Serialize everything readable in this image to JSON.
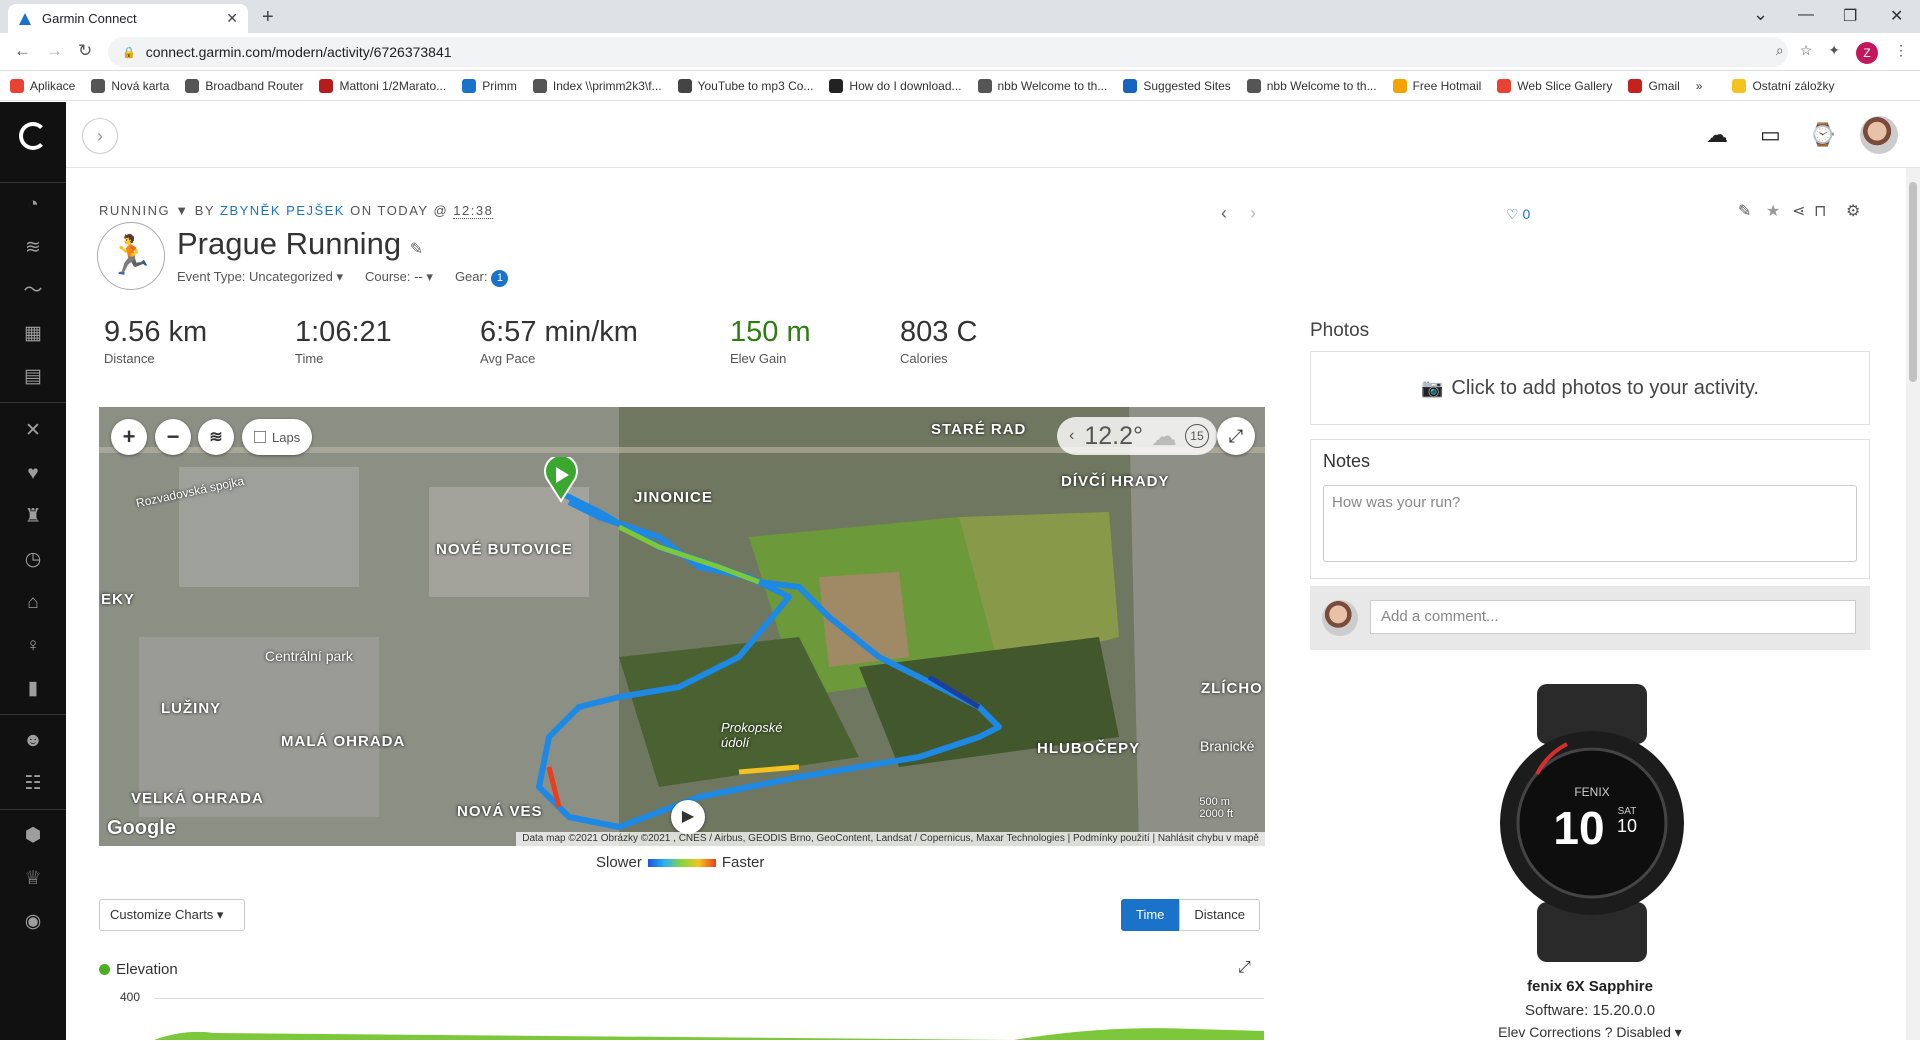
{
  "browser": {
    "tab_title": "Garmin Connect",
    "url": "connect.garmin.com/modern/activity/6726373841",
    "profile_initial": "Z",
    "bookmarks": [
      "Aplikace",
      "Nová karta",
      "Broadband Router",
      "Mattoni 1/2Marato...",
      "Primm",
      "Index \\\\primm2k3\\f...",
      "YouTube to mp3 Co...",
      "How do I download...",
      "nbb Welcome to th...",
      "Suggested Sites",
      "nbb Welcome to th...",
      "Free Hotmail",
      "Web Slice Gallery",
      "Gmail",
      "»",
      "Ostatní záložky"
    ]
  },
  "activity": {
    "type_label": "RUNNING",
    "by_label": "BY",
    "author": "ZBYNĚK PEJŠEK",
    "on_label": "ON TODAY @",
    "time": "12:38",
    "title": "Prague Running",
    "event_type": "Event Type: Uncategorized ▾",
    "course": "Course: -- ▾",
    "gear_label": "Gear:",
    "gear_count": "1",
    "likes": "0"
  },
  "stats": [
    {
      "value": "9.56 km",
      "label": "Distance"
    },
    {
      "value": "1:06:21",
      "label": "Time"
    },
    {
      "value": "6:57 min/km",
      "label": "Avg Pace"
    },
    {
      "value": "150 m",
      "label": "Elev Gain"
    },
    {
      "value": "803 C",
      "label": "Calories"
    }
  ],
  "map": {
    "laps_label": "Laps",
    "temperature": "12.2°",
    "weather_badge": "15",
    "labels": [
      "STARÉ RAD",
      "JINONICE",
      "DÍVČÍ HRADY",
      "NOVÉ BUTOVICE",
      "Rozvadovská spojka",
      "Centrální park",
      "LUŽINY",
      "MALÁ OHRADA",
      "VELKÁ OHRADA",
      "NOVÁ VES",
      "Prokopské údolí",
      "HLUBOČEPY",
      "ZLÍCHO",
      "Branické",
      "EKY"
    ],
    "scale_1": "500 m",
    "scale_2": "2000 ft",
    "attribution": "Data map ©2021 Obrázky ©2021 , CNES / Airbus, GEODIS Brno, GeoContent, Landsat / Copernicus, Maxar Technologies | Podmínky použití | Nahlásit chybu v mapě",
    "logo": "Google"
  },
  "legend": {
    "slow": "Slower",
    "fast": "Faster"
  },
  "charts": {
    "customize_label": "Customize Charts ▾",
    "time_label": "Time",
    "distance_label": "Distance",
    "elevation_title": "Elevation",
    "elevation_ytick": "400"
  },
  "photos": {
    "title": "Photos",
    "add_text": "Click to add photos to your activity."
  },
  "notes": {
    "title": "Notes",
    "placeholder": "How was your run?"
  },
  "comment": {
    "placeholder": "Add a comment..."
  },
  "device": {
    "name": "fenix 6X Sapphire",
    "software": "Software: 15.20.0.0",
    "elev_corrections": "Elev Corrections  ?  Disabled ▾",
    "watch_time": "10",
    "watch_date": "10",
    "watch_brand": "FENIX",
    "watch_day": "SAT"
  }
}
